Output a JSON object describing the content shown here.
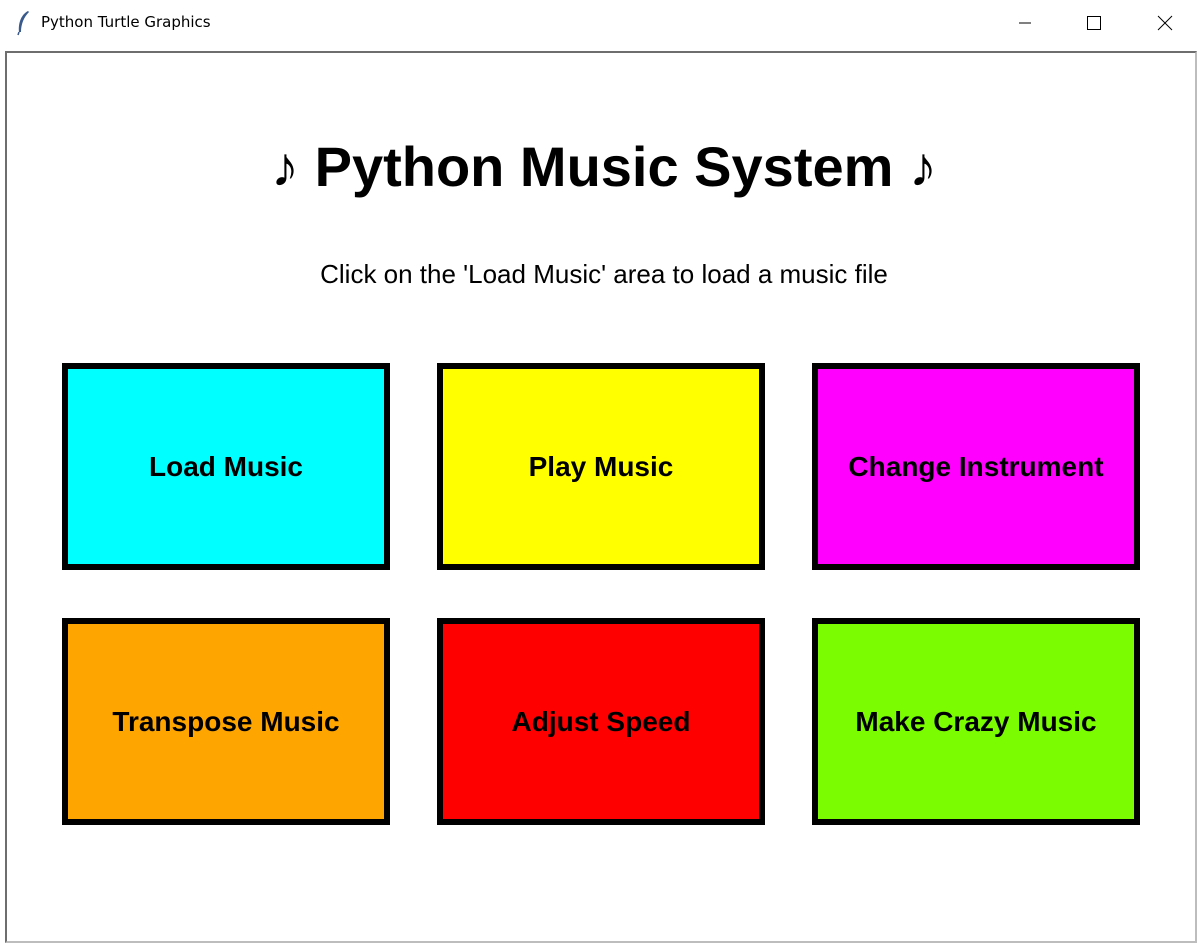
{
  "window": {
    "title": "Python Turtle Graphics",
    "icon": "feather-icon",
    "controls": [
      "minimize-icon",
      "maximize-icon",
      "close-icon"
    ]
  },
  "main": {
    "heading": "♪ Python Music System ♪",
    "instruction": "Click on the 'Load Music' area to load a music file"
  },
  "tiles": [
    {
      "label": "Load Music",
      "color": "#00ffff"
    },
    {
      "label": "Play Music",
      "color": "#ffff00"
    },
    {
      "label": "Change Instrument",
      "color": "#ff00ff"
    },
    {
      "label": "Transpose Music",
      "color": "#ffa500"
    },
    {
      "label": "Adjust Speed",
      "color": "#ff0000"
    },
    {
      "label": "Make Crazy Music",
      "color": "#7cfc00"
    }
  ]
}
